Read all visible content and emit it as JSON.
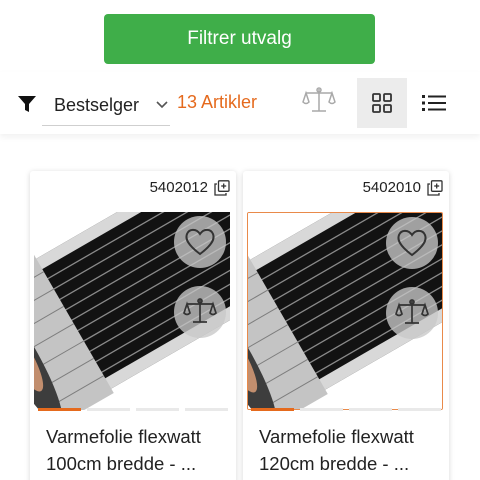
{
  "filter_button": {
    "label": "Filtrer utvalg"
  },
  "toolbar": {
    "sort_selected": "Bestselger",
    "article_count": "13 Artikler",
    "view_mode": "grid"
  },
  "products": [
    {
      "sku": "5402012",
      "title_line1": "Varmefolie flexwatt",
      "title_line2": "100cm bredde - ..."
    },
    {
      "sku": "5402010",
      "title_line1": "Varmefolie flexwatt",
      "title_line2": "120cm bredde - ..."
    }
  ],
  "colors": {
    "accent_green": "#3fae49",
    "accent_orange": "#e56a1d"
  },
  "icons": [
    "filter-icon",
    "chevron-down-icon",
    "compare-scale-icon",
    "grid-view-icon",
    "list-view-icon",
    "copy-icon",
    "heart-icon",
    "scale-icon"
  ]
}
